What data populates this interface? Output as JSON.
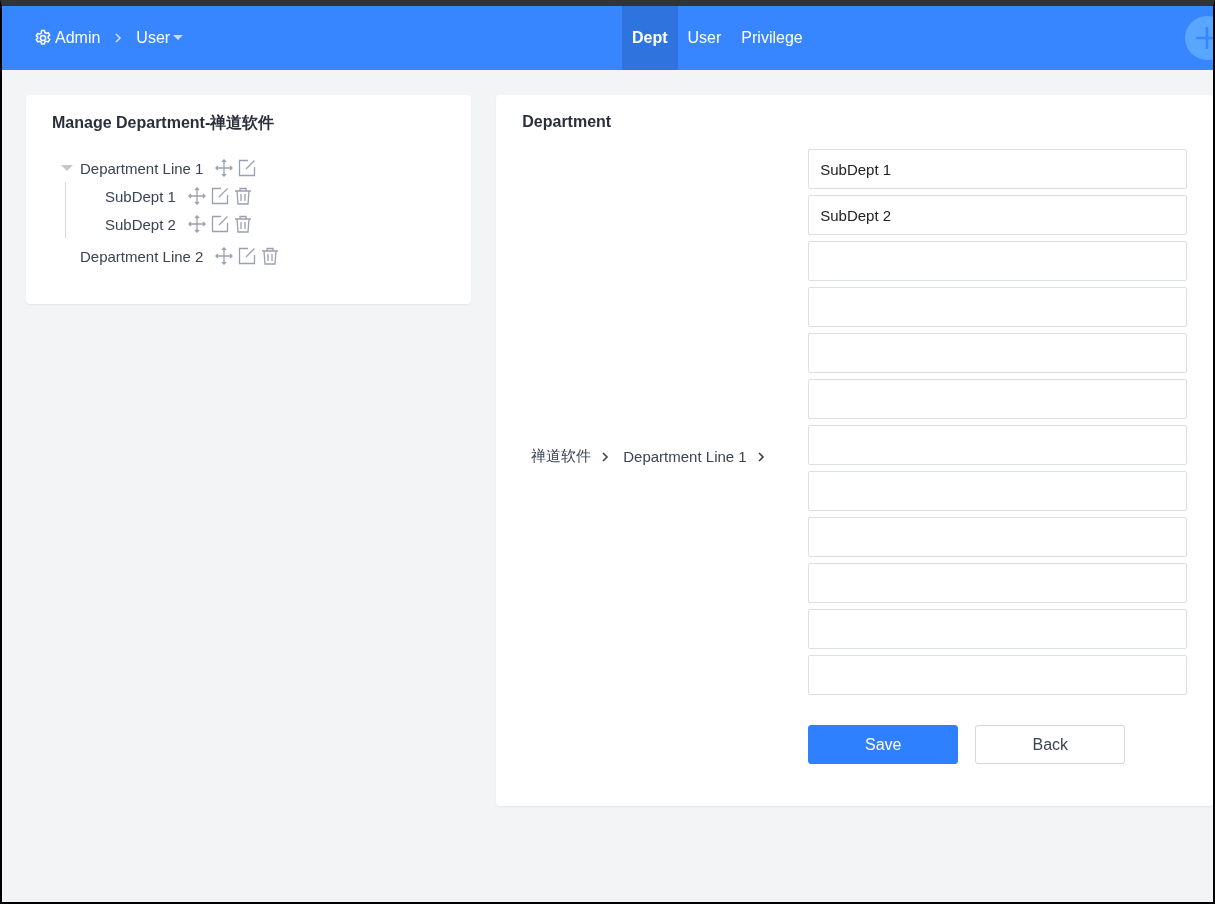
{
  "header": {
    "crumbs": [
      {
        "label": "Admin",
        "kind": "settings"
      },
      {
        "label": "User",
        "kind": "dropdown"
      }
    ],
    "tabs": [
      {
        "label": "Dept",
        "selected": true
      },
      {
        "label": "User",
        "selected": false
      },
      {
        "label": "Privilege",
        "selected": false
      }
    ]
  },
  "tree_panel": {
    "title": "Manage Department-禅道软件",
    "items": [
      {
        "label": "Department Line 1",
        "expanded": true,
        "movable": true,
        "editable": true,
        "deletable": false,
        "children": [
          {
            "label": "SubDept 1",
            "movable": true,
            "editable": true,
            "deletable": true
          },
          {
            "label": "SubDept 2",
            "movable": true,
            "editable": true,
            "deletable": true
          }
        ]
      },
      {
        "label": "Department Line 2",
        "movable": true,
        "editable": true,
        "deletable": true
      }
    ]
  },
  "form_panel": {
    "title": "Department",
    "path": [
      "禅道软件",
      "Department Line 1"
    ],
    "fields": [
      {
        "kind": "input",
        "value": "SubDept 1"
      },
      {
        "kind": "input",
        "value": "SubDept 2"
      },
      {
        "kind": "input"
      },
      {
        "kind": "input"
      },
      {
        "kind": "input"
      },
      {
        "kind": "input"
      },
      {
        "kind": "input"
      },
      {
        "kind": "input"
      },
      {
        "kind": "input"
      },
      {
        "kind": "input"
      },
      {
        "kind": "input"
      },
      {
        "kind": "input"
      }
    ],
    "buttons": [
      {
        "label": "Save",
        "kind": "primary"
      },
      {
        "label": "Back",
        "kind": "secondary"
      }
    ]
  }
}
